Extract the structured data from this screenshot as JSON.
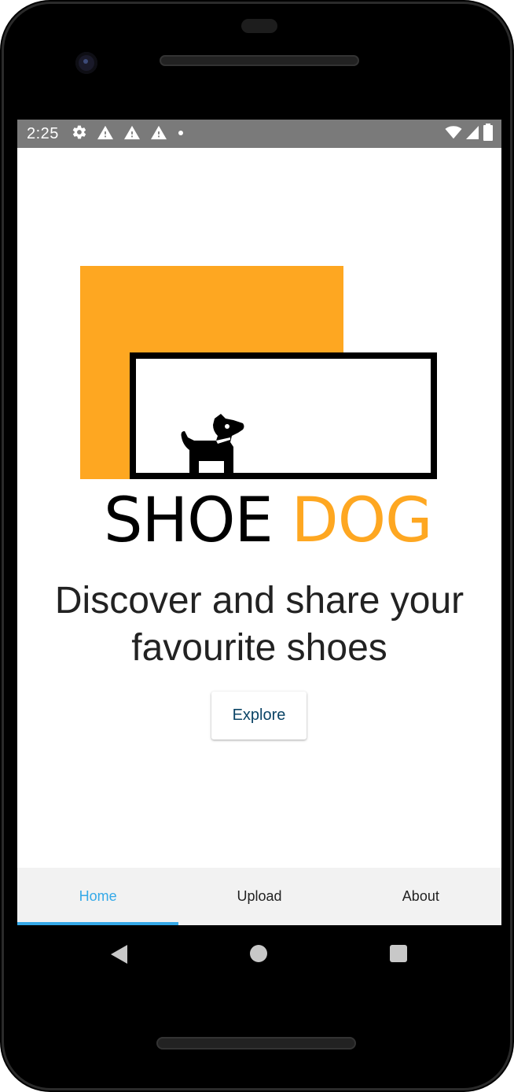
{
  "status_bar": {
    "time": "2:25",
    "left_icons": [
      "gear-icon",
      "warning-icon",
      "warning-icon",
      "warning-icon",
      "dot-icon"
    ],
    "right_icons": [
      "wifi-icon",
      "signal-icon",
      "battery-icon"
    ]
  },
  "brand": {
    "word1": "SHOE",
    "word2": "DOG",
    "accent_color": "#fea721",
    "logo_icon": "dog-icon"
  },
  "hero": {
    "tagline": "Discover and share your favourite shoes",
    "explore_label": "Explore"
  },
  "tabs": [
    {
      "label": "Home",
      "active": true
    },
    {
      "label": "Upload",
      "active": false
    },
    {
      "label": "About",
      "active": false
    }
  ],
  "theme": {
    "tab_active_color": "#35a9e8",
    "status_bar_color": "#7a7a7a",
    "tab_bar_color": "#f2f2f2"
  },
  "nav_bar": {
    "buttons": [
      "back-icon",
      "home-icon",
      "recents-icon"
    ]
  }
}
